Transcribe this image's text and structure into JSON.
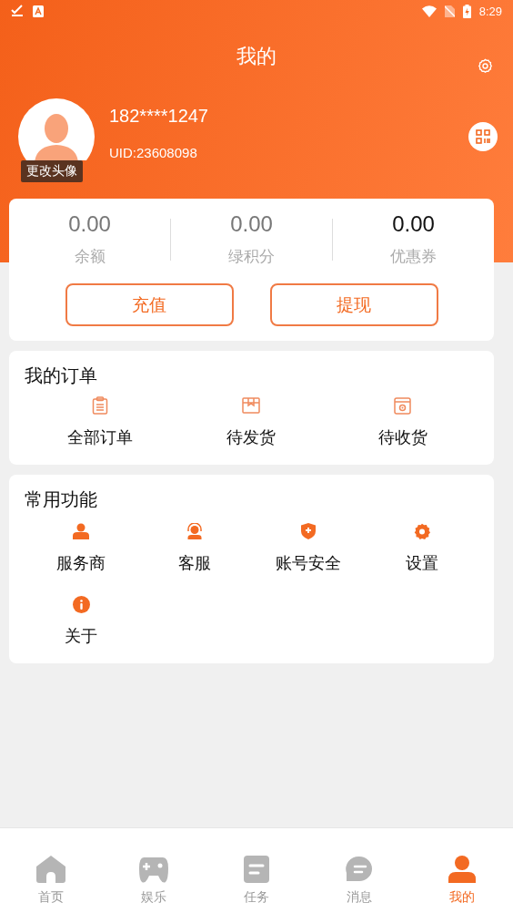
{
  "status_bar": {
    "time": "8:29"
  },
  "header": {
    "title": "我的"
  },
  "profile": {
    "phone": "182****1247",
    "uid": "UID:23608098",
    "avatar_label": "更改头像"
  },
  "stats": [
    {
      "value": "0.00",
      "label": "余额",
      "emphasized": false
    },
    {
      "value": "0.00",
      "label": "绿积分",
      "emphasized": false
    },
    {
      "value": "0.00",
      "label": "优惠券",
      "emphasized": true
    }
  ],
  "wallet_buttons": [
    "充值",
    "提现"
  ],
  "orders": {
    "title": "我的订单",
    "items": [
      {
        "label": "全部订单",
        "kind": "clipboard"
      },
      {
        "label": "待发货",
        "kind": "box"
      },
      {
        "label": "待收货",
        "kind": "package"
      }
    ]
  },
  "functions": {
    "title": "常用功能",
    "items": [
      {
        "label": "服务商",
        "kind": "person"
      },
      {
        "label": "客服",
        "kind": "headset"
      },
      {
        "label": "账号安全",
        "kind": "shield"
      },
      {
        "label": "设置",
        "kind": "gear"
      },
      {
        "label": "关于",
        "kind": "info"
      }
    ]
  },
  "tabs": [
    {
      "label": "首页",
      "kind": "home",
      "selected": false
    },
    {
      "label": "娱乐",
      "kind": "gamepad",
      "selected": false
    },
    {
      "label": "任务",
      "kind": "task",
      "selected": false
    },
    {
      "label": "消息",
      "kind": "chat",
      "selected": false
    },
    {
      "label": "我的",
      "kind": "user",
      "selected": true
    }
  ]
}
